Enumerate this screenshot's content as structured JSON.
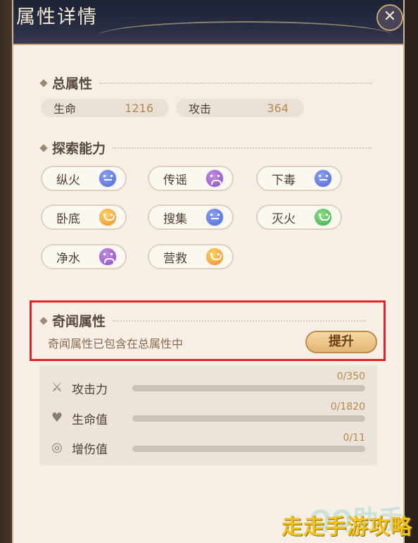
{
  "header": {
    "title": "属性详情"
  },
  "total": {
    "title": "总属性",
    "stats": [
      {
        "label": "生命",
        "value": "1216"
      },
      {
        "label": "攻击",
        "value": "364"
      }
    ]
  },
  "explore": {
    "title": "探索能力",
    "items": [
      {
        "label": "纵火",
        "mood": "neutral"
      },
      {
        "label": "传谣",
        "mood": "sad"
      },
      {
        "label": "下毒",
        "mood": "neutral"
      },
      {
        "label": "卧底",
        "mood": "happy"
      },
      {
        "label": "搜集",
        "mood": "neutral"
      },
      {
        "label": "灭火",
        "mood": "smile"
      },
      {
        "label": "净水",
        "mood": "sad"
      },
      {
        "label": "营救",
        "mood": "happy"
      }
    ]
  },
  "qiwen": {
    "title": "奇闻属性",
    "desc": "奇闻属性已包含在总属性中",
    "upgrade_label": "提升"
  },
  "bonus_stats": [
    {
      "label": "攻击力",
      "value": "0/350",
      "progress": 0,
      "icon": "sword-icon"
    },
    {
      "label": "生命值",
      "value": "0/1820",
      "progress": 0,
      "icon": "heart-plus-icon"
    },
    {
      "label": "增伤值",
      "value": "0/11",
      "progress": 0,
      "icon": "damage-boost-icon"
    }
  ],
  "watermark": {
    "faint": "QQ助手",
    "main": "走走手游攻略"
  },
  "colors": {
    "accent": "#b8864d",
    "highlight_border": "#e0242a",
    "watermark": "#f1c21b"
  }
}
